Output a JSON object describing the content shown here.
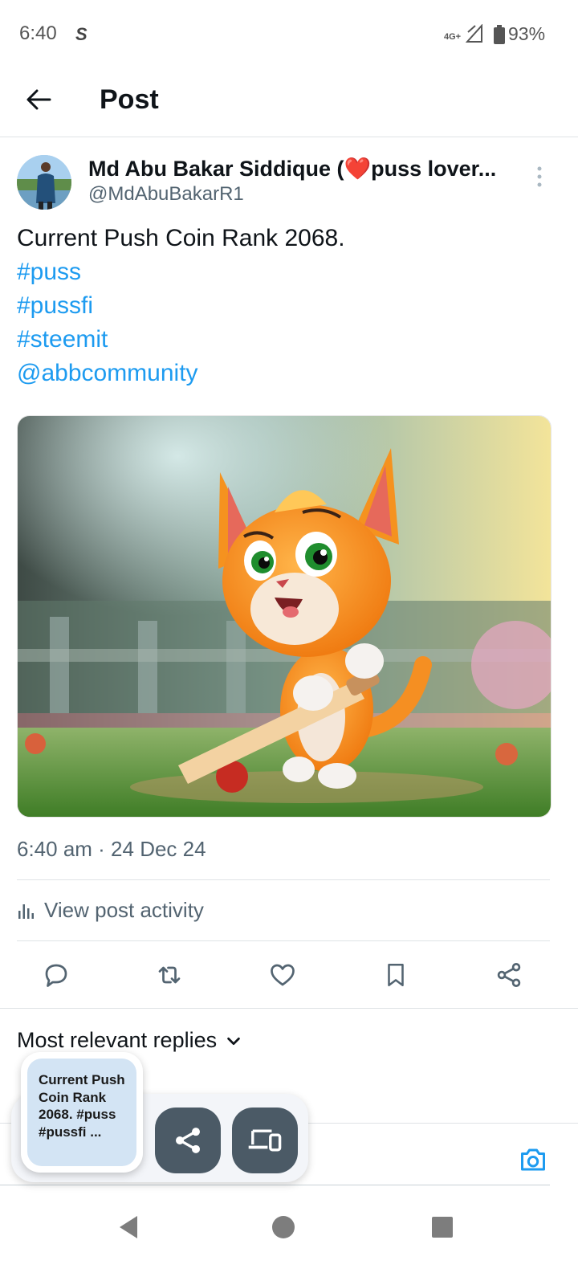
{
  "status_bar": {
    "time": "6:40",
    "carrier_icon": "s-app-icon",
    "network": "4G+",
    "battery": "93%"
  },
  "top_bar": {
    "back_icon": "arrow-left-icon",
    "title": "Post"
  },
  "post": {
    "author_name": "Md Abu Bakar Siddique (❤️puss lover...",
    "author_handle": "@MdAbuBakarR1",
    "text": "Current Push Coin Rank 2068.",
    "hashtags": [
      "#puss",
      "#pussfi",
      "#steemit"
    ],
    "mention": "@abbcommunity",
    "timestamp": "6:40 am · 24 Dec 24",
    "activity_label": "View post activity",
    "accent_color": "#1d9bf0"
  },
  "actions": [
    {
      "icon": "reply-icon"
    },
    {
      "icon": "repost-icon"
    },
    {
      "icon": "like-icon"
    },
    {
      "icon": "bookmark-icon"
    },
    {
      "icon": "share-icon"
    }
  ],
  "replies": {
    "sort_label": "Most relevant replies",
    "sort_icon": "chevron-down-icon"
  },
  "share_overlay": {
    "preview_text": "Current Push Coin Rank 2068. #puss #pussfi ...",
    "buttons": [
      "share-icon",
      "devices-icon"
    ]
  },
  "nav_bar": [
    "back",
    "home",
    "recents"
  ]
}
